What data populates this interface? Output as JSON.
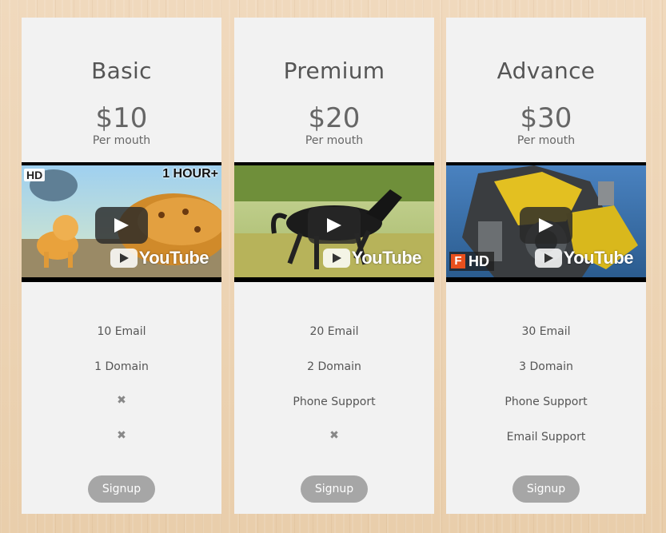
{
  "plans": [
    {
      "name": "Basic",
      "price": "$10",
      "period": "Per mouth",
      "video": {
        "brand": "YouTube",
        "badges": [
          "HD",
          "1 HOUR+"
        ]
      },
      "features": [
        "10 Email",
        "1 Domain",
        "✖",
        "✖"
      ],
      "signup_label": "Signup"
    },
    {
      "name": "Premium",
      "price": "$20",
      "period": "Per mouth",
      "video": {
        "brand": "YouTube",
        "badges": []
      },
      "features": [
        "20 Email",
        "2 Domain",
        "Phone Support",
        "✖"
      ],
      "signup_label": "Signup"
    },
    {
      "name": "Advance",
      "price": "$30",
      "period": "Per mouth",
      "video": {
        "brand": "YouTube",
        "badges": [
          "F",
          "HD"
        ]
      },
      "features": [
        "30 Email",
        "3 Domain",
        "Phone Support",
        "Email Support"
      ],
      "signup_label": "Signup"
    }
  ],
  "colors": {
    "card_bg": "#f2f2f2",
    "button_bg": "#a6a6a6",
    "button_text": "#ffffff",
    "page_bg": "#ecd3b2"
  },
  "icons": {
    "play": "play-icon",
    "youtube": "youtube-icon",
    "unavailable": "cross-icon"
  }
}
